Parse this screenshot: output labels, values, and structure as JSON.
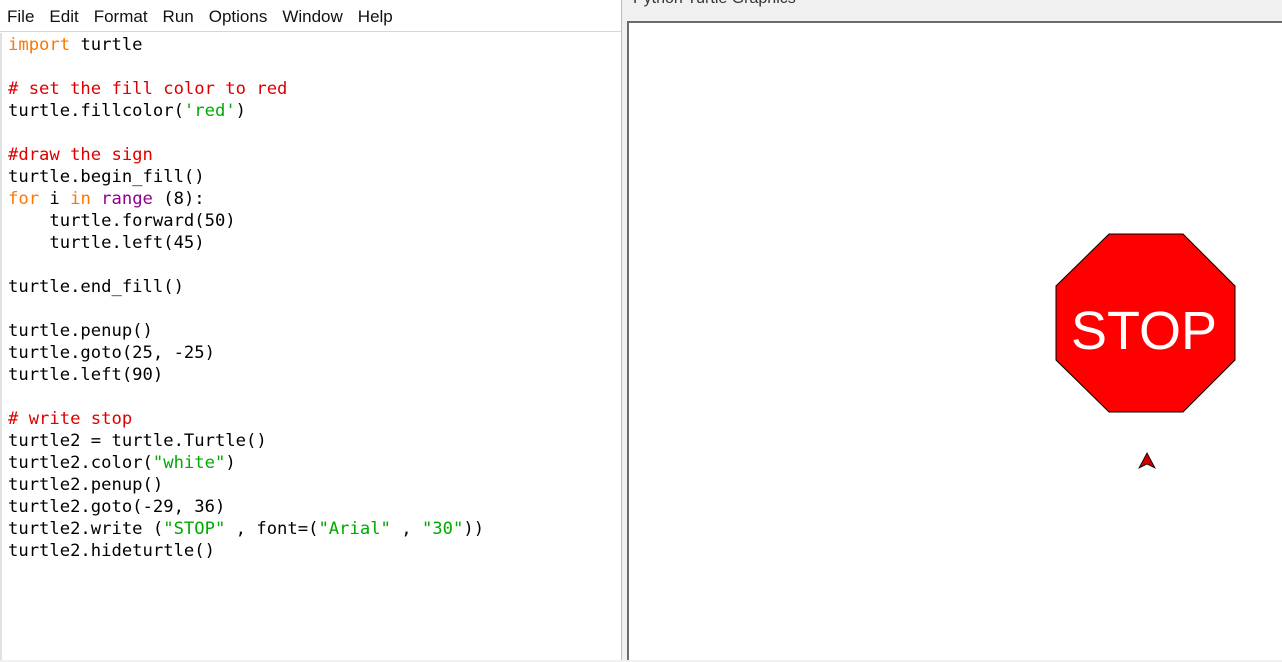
{
  "editor": {
    "menu": [
      "File",
      "Edit",
      "Format",
      "Run",
      "Options",
      "Window",
      "Help"
    ],
    "lines": [
      [
        {
          "t": "keyword",
          "s": "import"
        },
        {
          "t": "plain",
          "s": " turtle"
        }
      ],
      [],
      [
        {
          "t": "comment",
          "s": "# set the fill color to red"
        }
      ],
      [
        {
          "t": "plain",
          "s": "turtle.fillcolor("
        },
        {
          "t": "string",
          "s": "'red'"
        },
        {
          "t": "plain",
          "s": ")"
        }
      ],
      [],
      [
        {
          "t": "comment",
          "s": "#draw the sign"
        }
      ],
      [
        {
          "t": "plain",
          "s": "turtle.begin_fill()"
        }
      ],
      [
        {
          "t": "keyword",
          "s": "for"
        },
        {
          "t": "plain",
          "s": " i "
        },
        {
          "t": "keyword",
          "s": "in"
        },
        {
          "t": "plain",
          "s": " "
        },
        {
          "t": "builtin",
          "s": "range"
        },
        {
          "t": "plain",
          "s": " (8):"
        }
      ],
      [
        {
          "t": "plain",
          "s": "    turtle.forward(50)"
        }
      ],
      [
        {
          "t": "plain",
          "s": "    turtle.left(45)"
        }
      ],
      [],
      [
        {
          "t": "plain",
          "s": "turtle.end_fill()"
        }
      ],
      [],
      [
        {
          "t": "plain",
          "s": "turtle.penup()"
        }
      ],
      [
        {
          "t": "plain",
          "s": "turtle.goto(25, -25)"
        }
      ],
      [
        {
          "t": "plain",
          "s": "turtle.left(90)"
        }
      ],
      [],
      [
        {
          "t": "comment",
          "s": "# write stop"
        }
      ],
      [
        {
          "t": "plain",
          "s": "turtle2 = turtle.Turtle()"
        }
      ],
      [
        {
          "t": "plain",
          "s": "turtle2.color("
        },
        {
          "t": "string",
          "s": "\"white\""
        },
        {
          "t": "plain",
          "s": ")"
        }
      ],
      [
        {
          "t": "plain",
          "s": "turtle2.penup()"
        }
      ],
      [
        {
          "t": "plain",
          "s": "turtle2.goto(-29, 36)"
        }
      ],
      [
        {
          "t": "plain",
          "s": "turtle2.write ("
        },
        {
          "t": "string",
          "s": "\"STOP\""
        },
        {
          "t": "plain",
          "s": " , font=("
        },
        {
          "t": "string",
          "s": "\"Arial\""
        },
        {
          "t": "plain",
          "s": " , "
        },
        {
          "t": "string",
          "s": "\"30\""
        },
        {
          "t": "plain",
          "s": "))"
        }
      ],
      [
        {
          "t": "plain",
          "s": "turtle2.hideturtle()"
        }
      ]
    ]
  },
  "turtle_window": {
    "title": "Python Turtle Graphics",
    "sign_text": "STOP",
    "sign_fill": "#ff0000",
    "sign_text_color": "#ffffff",
    "turtle_cursor_color": "#cc0000",
    "turtle_cursor_icon": "turtle-arrow-icon"
  },
  "colors": {
    "keyword": "#ff7700",
    "builtin": "#900090",
    "comment": "#dd0000",
    "string": "#00aa00"
  }
}
